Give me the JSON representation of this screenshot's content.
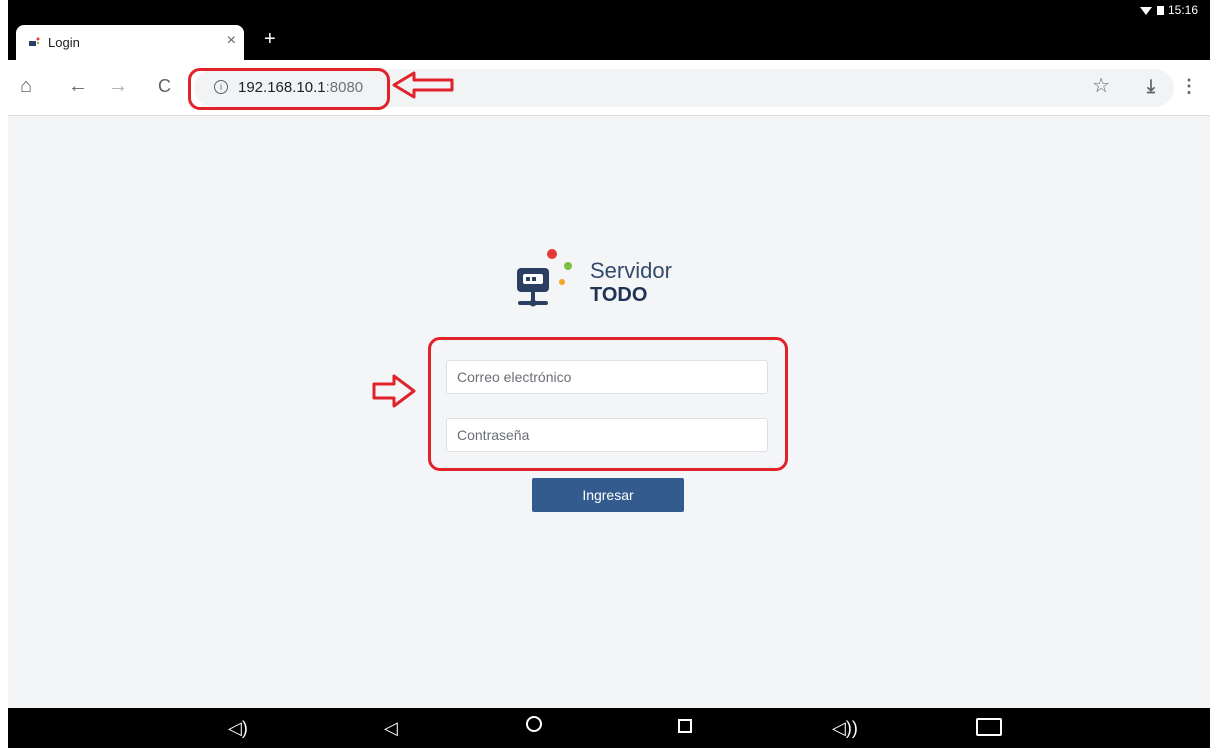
{
  "status_bar": {
    "time": "15:16"
  },
  "browser": {
    "tab": {
      "title": "Login",
      "close_symbol": "×"
    },
    "new_tab_symbol": "+",
    "toolbar": {
      "home_symbol": "⌂",
      "back_symbol": "←",
      "forward_symbol": "→",
      "reload_symbol": "C",
      "info_symbol": "i",
      "url_host": "192.168.10.1",
      "url_port": ":8080",
      "bookmark_symbol": "☆",
      "download_symbol": "⤓",
      "menu_symbol": "⋮"
    }
  },
  "page": {
    "logo": {
      "line1": "Servidor",
      "line2": "TODO"
    },
    "email": {
      "placeholder": "Correo electrónico"
    },
    "password": {
      "placeholder": "Contraseña"
    },
    "login_button": "Ingresar"
  },
  "annotations": {
    "color": "#e0222a"
  },
  "nav_bar": {
    "volume_down_symbol": "◁)",
    "back_symbol": "◁",
    "volume_up_symbol": "◁))"
  },
  "colors": {
    "button": "#345b8e",
    "logo_text": "#1f3354",
    "page_bg": "#f4f5f7"
  },
  "icons": [
    "home-icon",
    "back-icon",
    "forward-icon",
    "reload-icon",
    "info-icon",
    "bookmark-star-icon",
    "download-icon",
    "menu-icon",
    "server-logo-icon"
  ]
}
